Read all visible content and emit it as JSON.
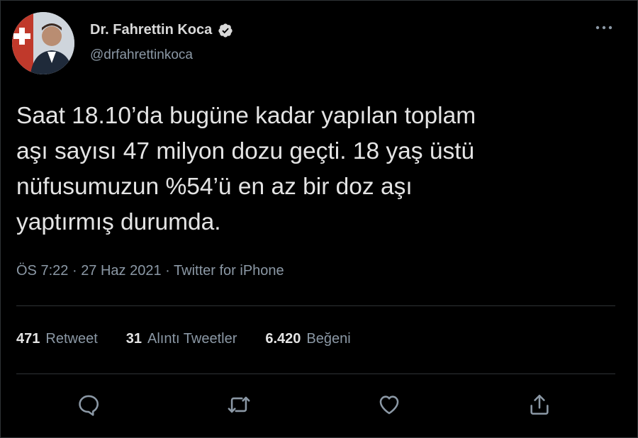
{
  "colors": {
    "background": "#000000",
    "text": "#e4e4e4",
    "secondary": "#8b98a5",
    "divider": "#2f3336"
  },
  "author": {
    "name": "Dr. Fahrettin Koca",
    "handle": "@drfahrettinkoca",
    "verified": true,
    "avatar_icon": "profile-photo"
  },
  "tweet": {
    "text": "Saat 18.10’da bugüne kadar yapılan toplam\naşı sayısı 47 milyon dozu geçti. 18 yaş üstü\nnüfusumuzun %54’ü en az bir doz aşı\nyaptırmış durumda."
  },
  "meta": {
    "time": "ÖS 7:22",
    "separator": "·",
    "date": "27 Haz 2021",
    "source": "Twitter for iPhone"
  },
  "stats": {
    "retweets": {
      "count": "471",
      "label": "Retweet"
    },
    "quotes": {
      "count": "31",
      "label": "Alıntı Tweetler"
    },
    "likes": {
      "count": "6.420",
      "label": "Beğeni"
    }
  },
  "actions": [
    "reply-icon",
    "retweet-icon",
    "like-icon",
    "share-icon"
  ]
}
